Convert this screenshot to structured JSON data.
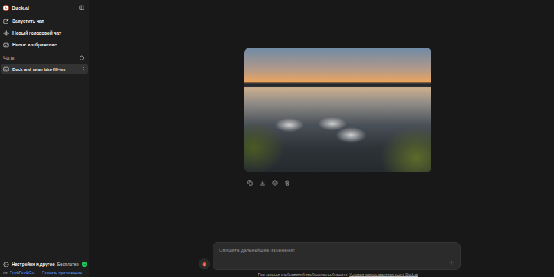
{
  "sidebar": {
    "logo": "Duck.ai",
    "actions": [
      {
        "label": "Запустить чат"
      },
      {
        "label": "Новый голосовой чат"
      },
      {
        "label": "Новое изображение"
      }
    ],
    "section": "Чаты",
    "chats": [
      {
        "label": "Duck and swan lake fill-ins",
        "selected": true
      }
    ],
    "settings": {
      "label": "Настройки и другое",
      "plan": "Бесплатно"
    },
    "footer": {
      "by": "от",
      "brand": "DuckDuckGo",
      "download": "Скачать приложение"
    }
  },
  "composer": {
    "placeholder": "Опишите дальнейшие изменения"
  },
  "disclaimer": {
    "text": "При запросе изображений необходимо соблюдать",
    "link": "Условия предоставления услуг Duck.ai"
  }
}
